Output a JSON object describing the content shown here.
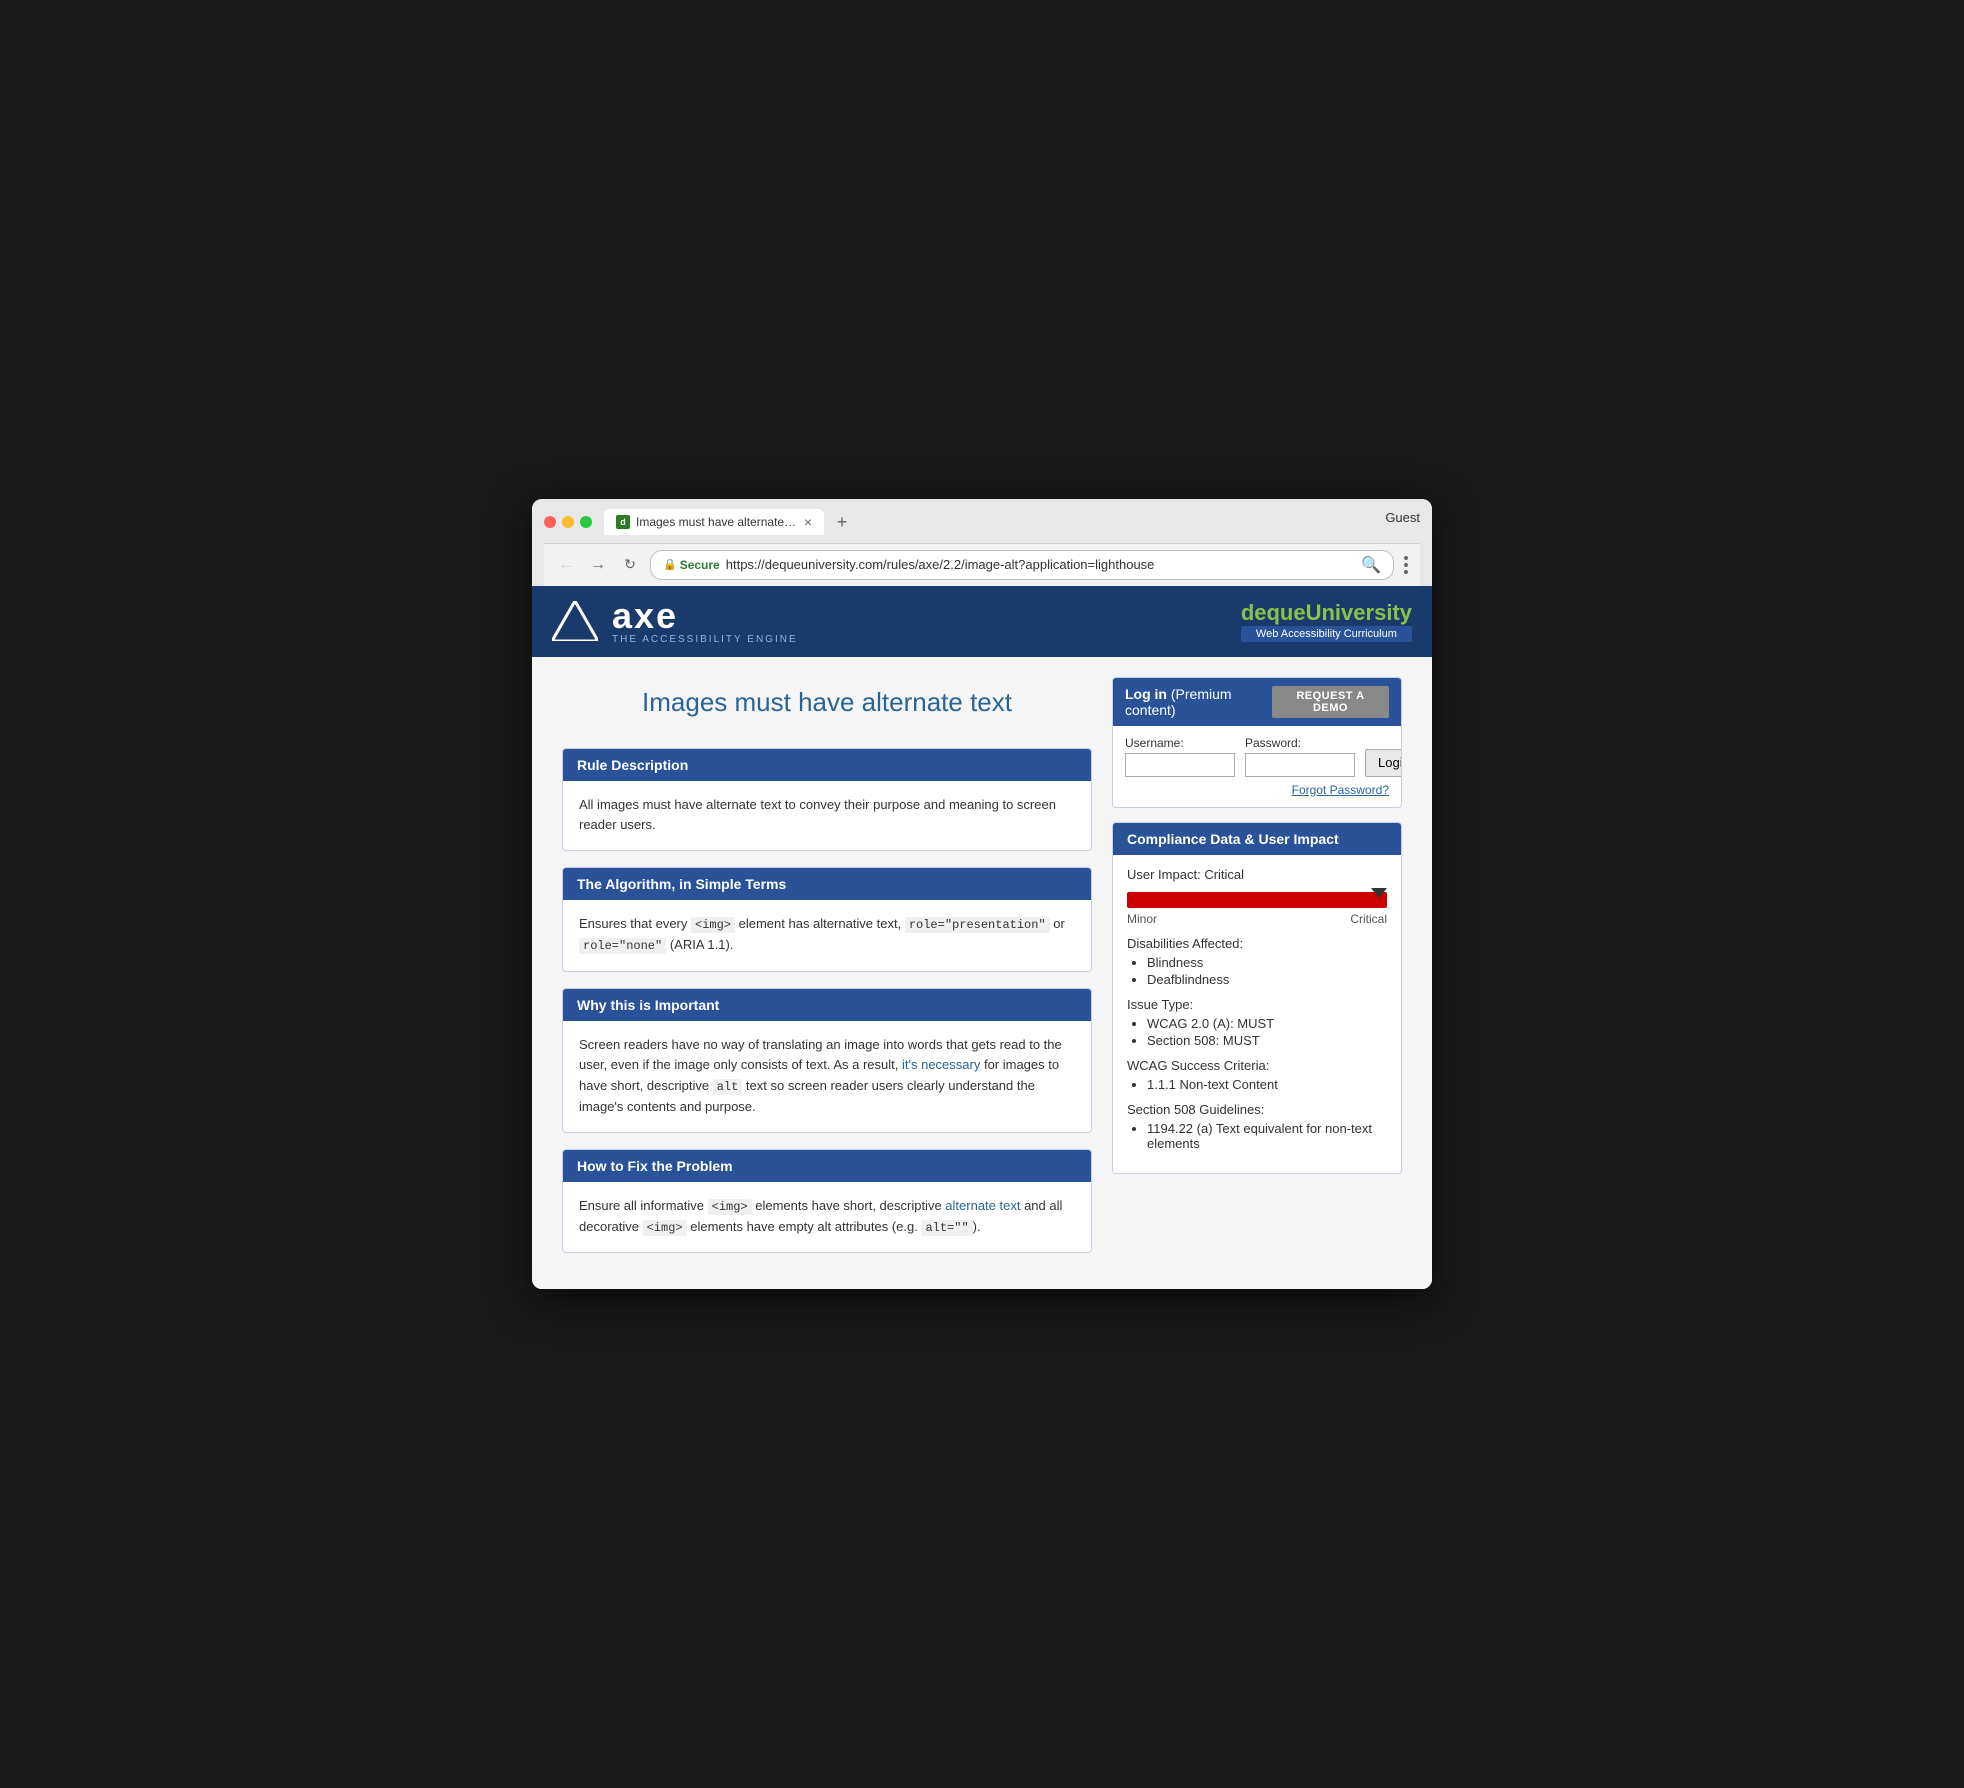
{
  "browser": {
    "tab_title": "Images must have alternate te…",
    "tab_favicon_letter": "d",
    "guest_label": "Guest",
    "back_btn": "←",
    "forward_btn": "→",
    "secure_label": "Secure",
    "url_full": "https://dequeuniversity.com/rules/axe/2.2/image-alt?application=lighthouse",
    "url_base": "https://dequeuniversity.com",
    "url_path": "/rules/axe/2.2/image-alt?application=lighthouse"
  },
  "header": {
    "axe_name": "axe",
    "axe_subtitle": "THE ACCESSIBILITY ENGINE",
    "deque_prefix": "deque",
    "deque_suffix": "University",
    "deque_tagline": "Web Accessibility Curriculum"
  },
  "page": {
    "title": "Images must have alternate text"
  },
  "login": {
    "header_text_plain": "Log in",
    "header_text_paren": "(Premium content)",
    "request_demo_btn": "REQUEST A DEMO",
    "username_label": "Username:",
    "password_label": "Password:",
    "login_btn": "Login",
    "forgot_link": "Forgot Password?"
  },
  "cards": [
    {
      "id": "rule-description",
      "header": "Rule Description",
      "body": "All images must have alternate text to convey their purpose and meaning to screen reader users."
    },
    {
      "id": "algorithm",
      "header": "The Algorithm, in Simple Terms",
      "body_html": true,
      "body": "Ensures that every <img> element has alternative text, role=\"presentation\" or role=\"none\" (ARIA 1.1)."
    },
    {
      "id": "why-important",
      "header": "Why this is Important",
      "body": "Screen readers have no way of translating an image into words that gets read to the user, even if the image only consists of text. As a result, it's necessary for images to have short, descriptive alt text so screen reader users clearly understand the image's contents and purpose."
    },
    {
      "id": "how-to-fix",
      "header": "How to Fix the Problem",
      "body": "Ensure all informative <img> elements have short, descriptive alternate text and all decorative <img> elements have empty alt attributes (e.g. alt=\"\")."
    }
  ],
  "compliance": {
    "header": "Compliance Data & User Impact",
    "user_impact_label": "User Impact:",
    "user_impact_value": "Critical",
    "impact_bar_label_left": "Minor",
    "impact_bar_label_right": "Critical",
    "disabilities_label": "Disabilities Affected:",
    "disabilities": [
      "Blindness",
      "Deafblindness"
    ],
    "issue_type_label": "Issue Type:",
    "issue_types": [
      "WCAG 2.0 (A): MUST",
      "Section 508: MUST"
    ],
    "wcag_label": "WCAG Success Criteria:",
    "wcag_items": [
      "1.1.1 Non-text Content"
    ],
    "section508_label": "Section 508 Guidelines:",
    "section508_items": [
      "1194.22 (a) Text equivalent for non-text elements"
    ]
  }
}
